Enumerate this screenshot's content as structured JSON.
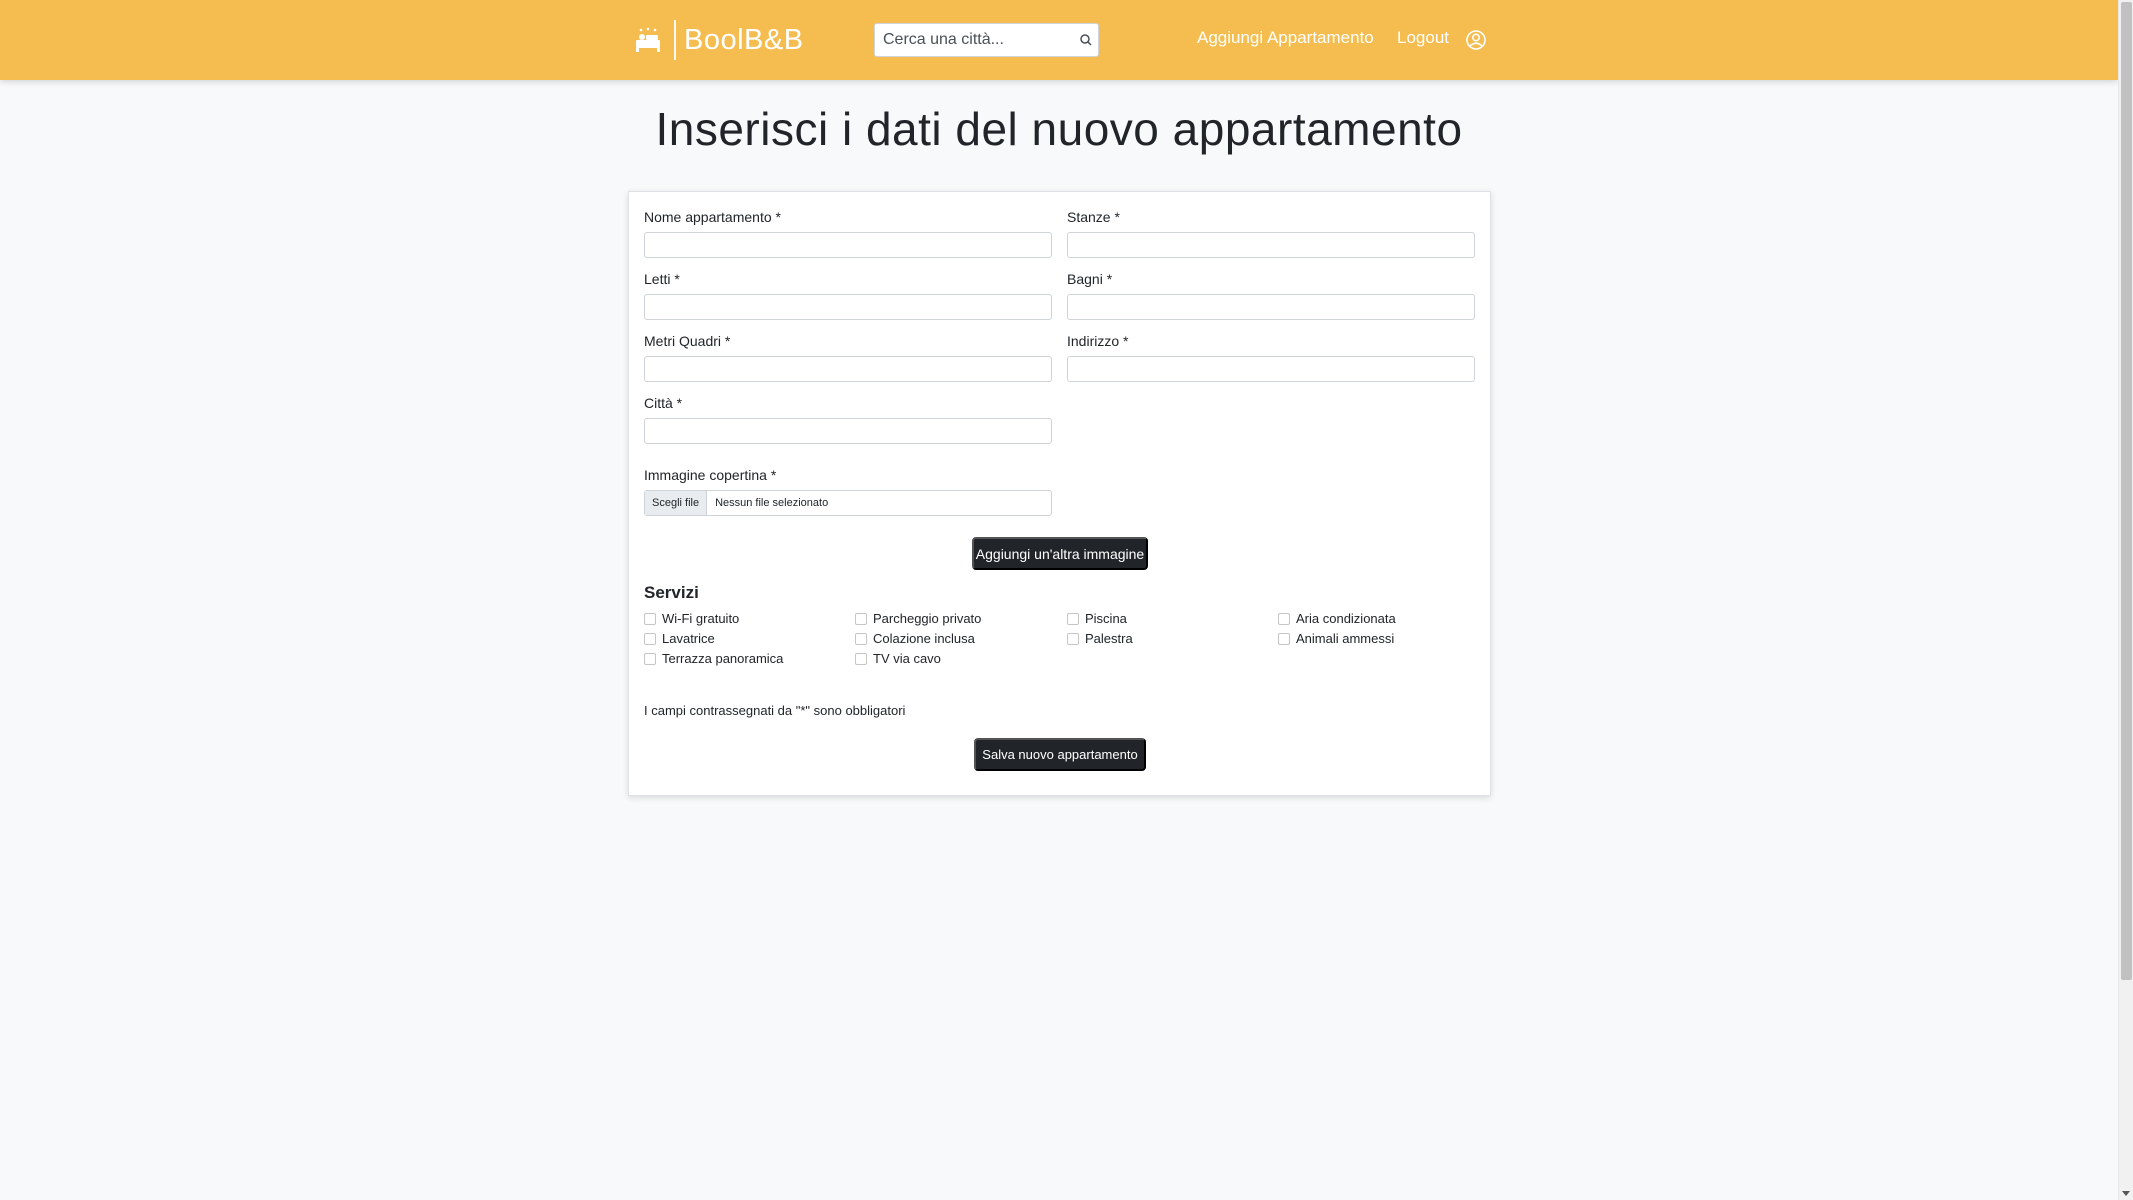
{
  "navbar": {
    "brand": "BoolB&B",
    "search_placeholder": "Cerca una città...",
    "add_apartment": "Aggiungi Appartamento",
    "logout": "Logout",
    "bg_color": "#f5bd4f"
  },
  "page_title": "Inserisci i dati del nuovo appartamento",
  "form": {
    "fields": {
      "nome": "Nome appartamento *",
      "stanze": "Stanze *",
      "letti": "Letti *",
      "bagni": "Bagni *",
      "metri": "Metri Quadri *",
      "indirizzo": "Indirizzo *",
      "citta": "Città *",
      "immagine": "Immagine copertina *"
    },
    "file_button": "Scegli file",
    "file_status": "Nessun file selezionato",
    "add_image_button": "Aggiungi un'altra immagine",
    "services_title": "Servizi",
    "services": [
      "Wi-Fi gratuito",
      "Parcheggio privato",
      "Piscina",
      "Aria condizionata",
      "Lavatrice",
      "Colazione inclusa",
      "Palestra",
      "Animali ammessi",
      "Terrazza panoramica",
      "TV via cavo"
    ],
    "required_note": "I campi contrassegnati da \"*\" sono obbligatori",
    "save_button": "Salva nuovo appartamento"
  },
  "icons": {
    "brand": "bed-icon",
    "search": "search-icon",
    "user": "user-circle-icon"
  }
}
